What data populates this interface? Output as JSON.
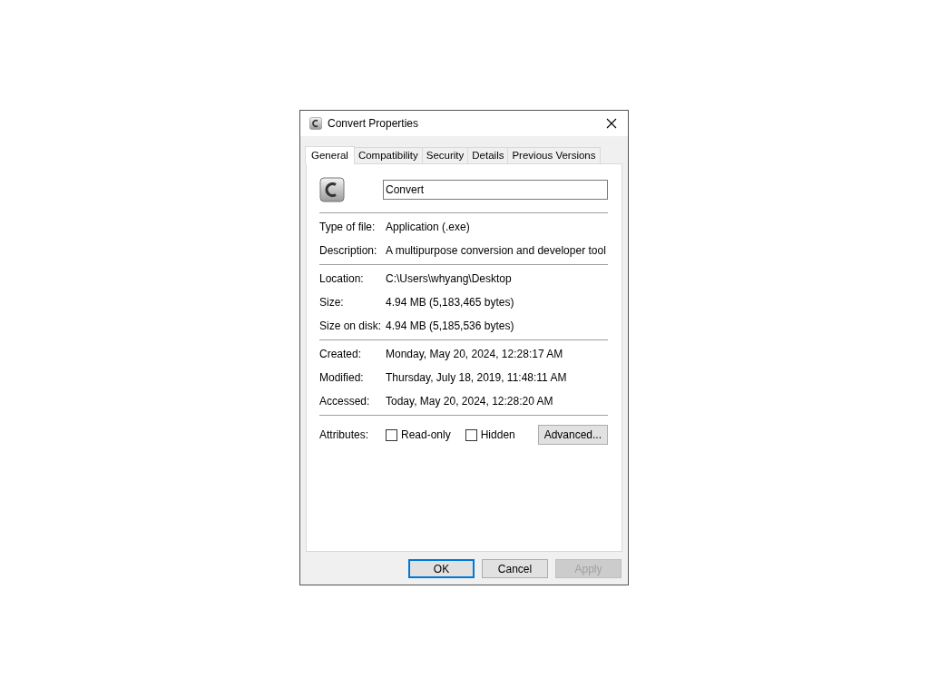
{
  "window": {
    "title": "Convert Properties"
  },
  "tabs": [
    {
      "label": "General",
      "selected": true
    },
    {
      "label": "Compatibility",
      "selected": false
    },
    {
      "label": "Security",
      "selected": false
    },
    {
      "label": "Details",
      "selected": false
    },
    {
      "label": "Previous Versions",
      "selected": false
    }
  ],
  "name_field": {
    "value": "Convert"
  },
  "sections": [
    [
      {
        "label": "Type of file:",
        "value": "Application (.exe)"
      },
      {
        "label": "Description:",
        "value": "A multipurpose conversion and developer tool"
      }
    ],
    [
      {
        "label": "Location:",
        "value": "C:\\Users\\whyang\\Desktop"
      },
      {
        "label": "Size:",
        "value": "4.94 MB (5,183,465 bytes)"
      },
      {
        "label": "Size on disk:",
        "value": "4.94 MB (5,185,536 bytes)"
      }
    ],
    [
      {
        "label": "Created:",
        "value": "Monday, May 20, 2024, 12:28:17 AM"
      },
      {
        "label": "Modified:",
        "value": "Thursday, July 18, 2019, 11:48:11 AM"
      },
      {
        "label": "Accessed:",
        "value": "Today, May 20, 2024, 12:28:20 AM"
      }
    ]
  ],
  "attributes": {
    "label": "Attributes:",
    "checkboxes": [
      {
        "label": "Read-only",
        "checked": false
      },
      {
        "label": "Hidden",
        "checked": false
      }
    ],
    "button": "Advanced..."
  },
  "buttons": [
    {
      "label": "OK",
      "kind": "default",
      "disabled": false
    },
    {
      "label": "Cancel",
      "kind": "normal",
      "disabled": false
    },
    {
      "label": "Apply",
      "kind": "normal",
      "disabled": true
    }
  ]
}
